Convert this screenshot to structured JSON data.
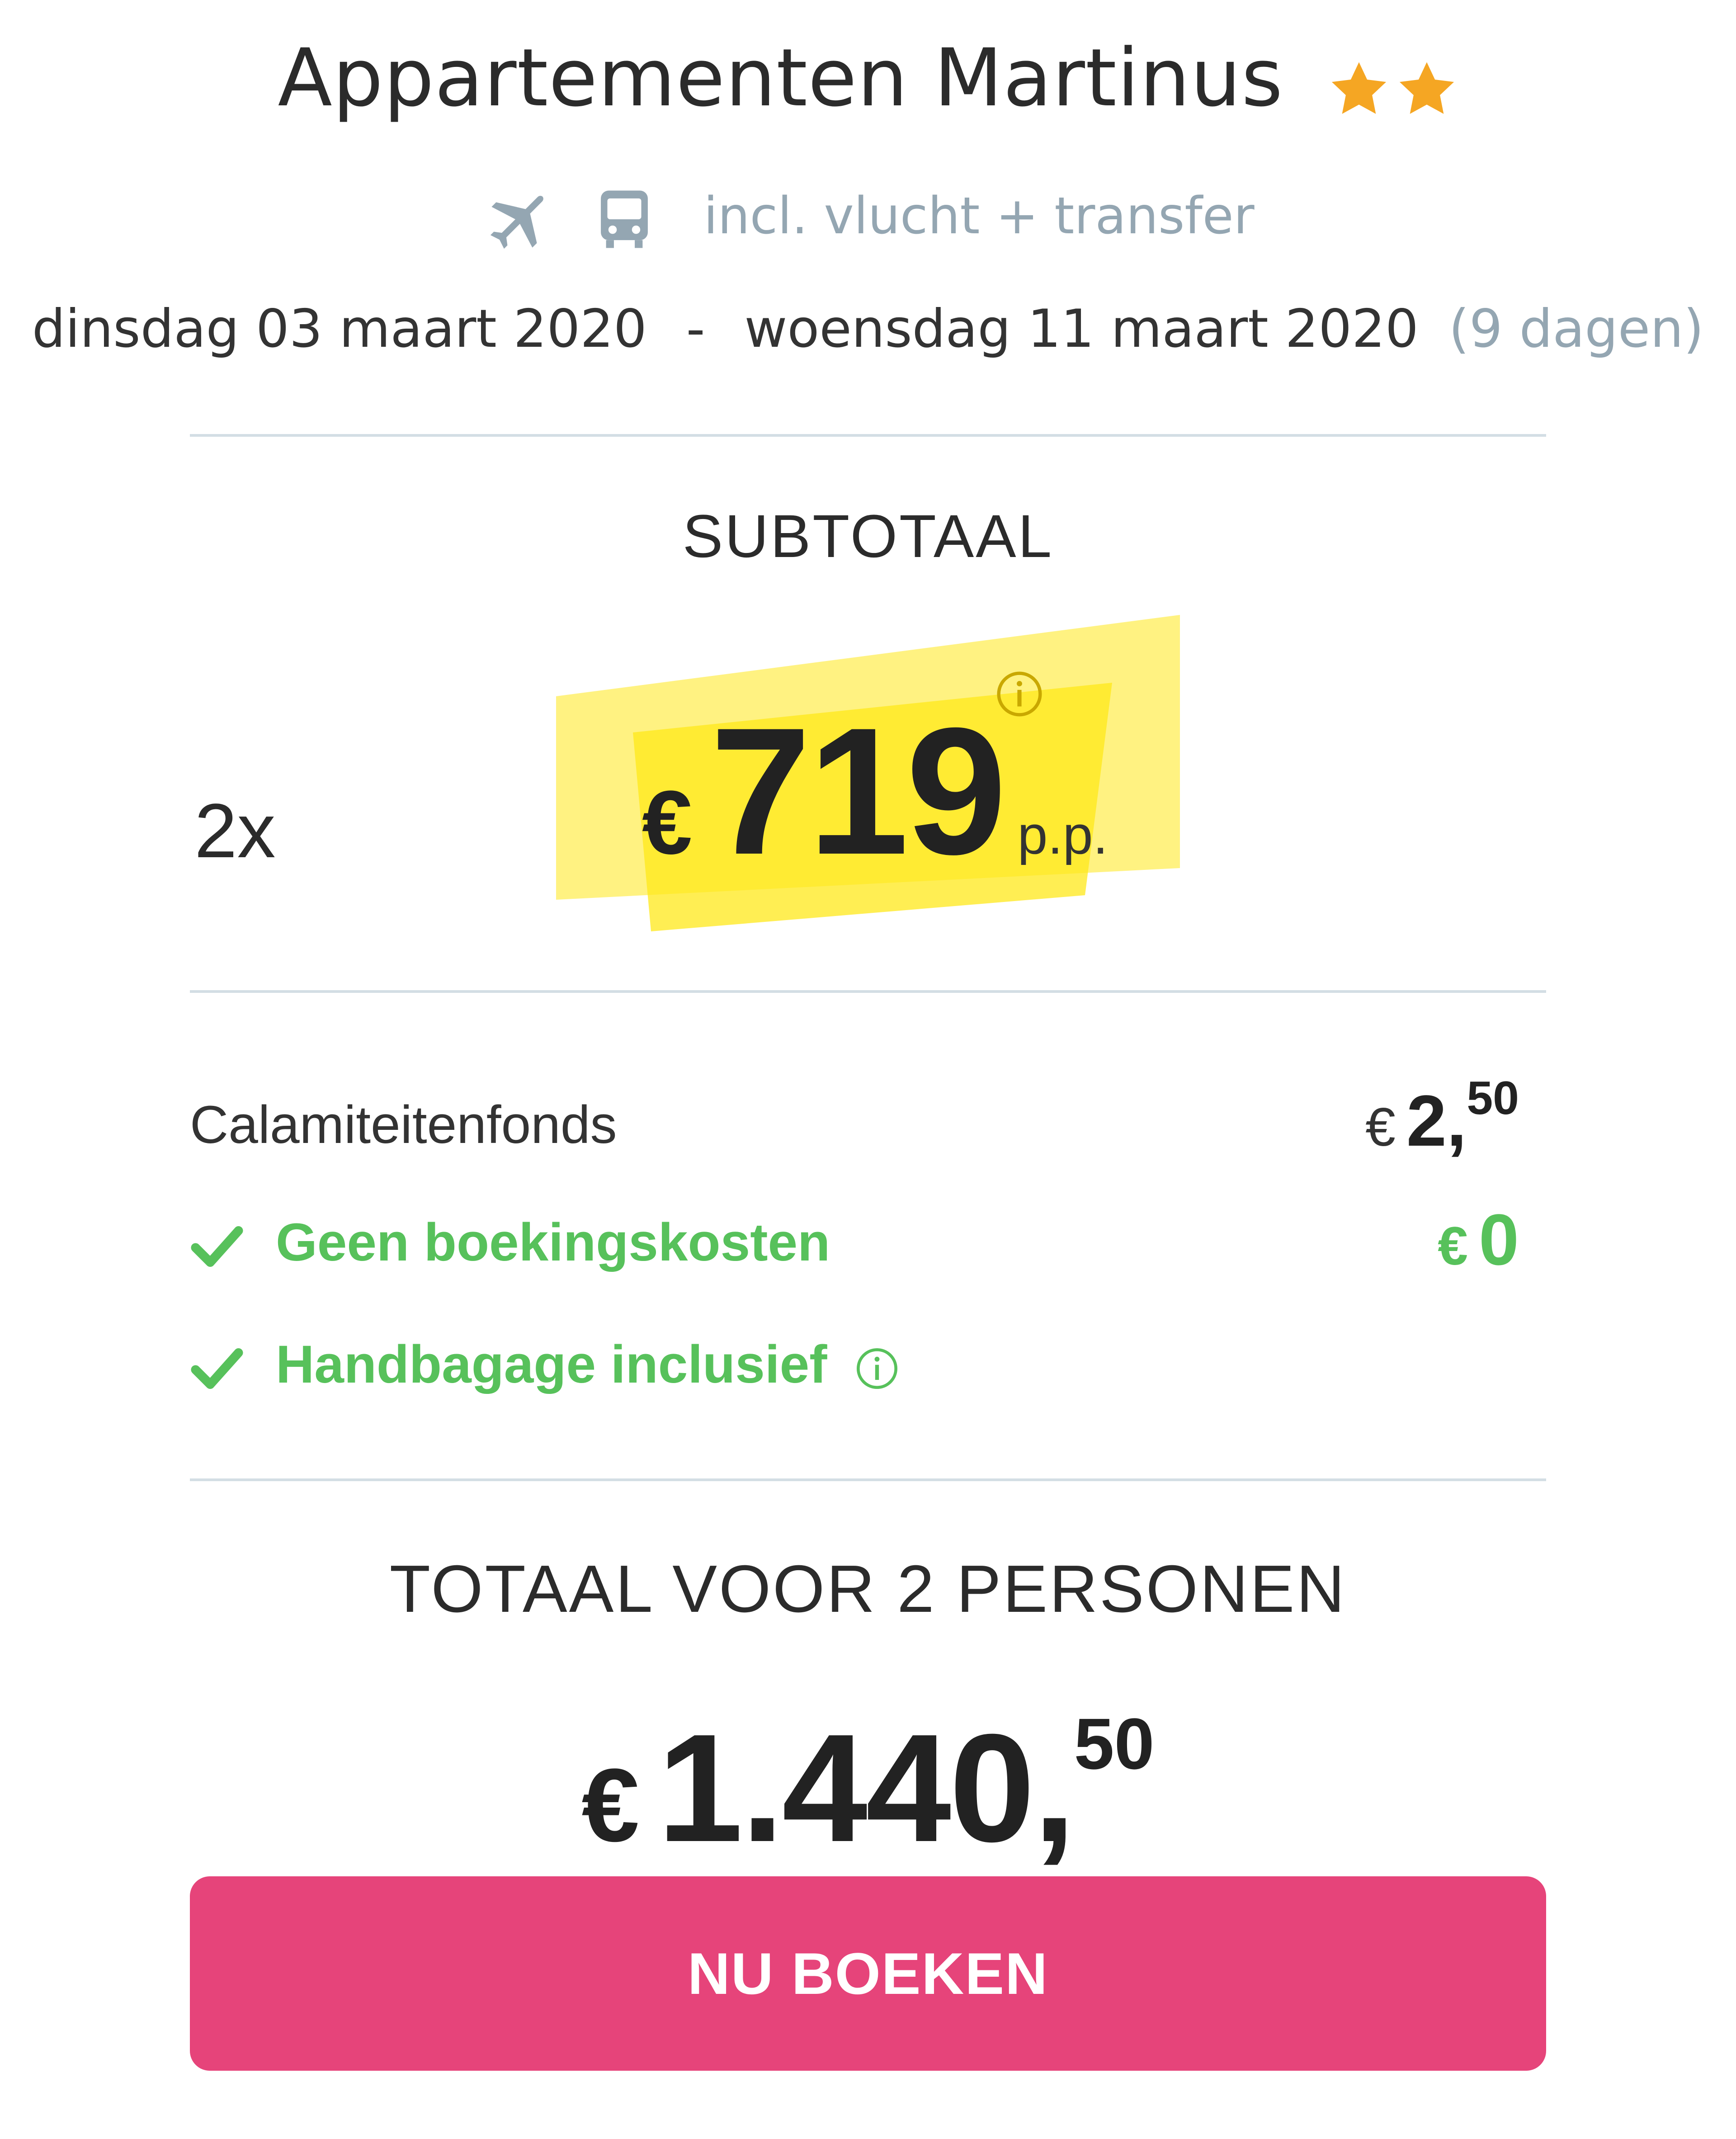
{
  "header": {
    "title": "Appartementen Martinus",
    "stars": 2,
    "travel_info": "incl. vlucht + transfer",
    "date_start": "dinsdag 03 maart 2020",
    "date_separator": "-",
    "date_end": "woensdag 11 maart 2020",
    "duration": "(9 dagen)"
  },
  "subtotal": {
    "label": "SUBTOTAAL",
    "quantity": "2x",
    "currency": "€",
    "price": "719",
    "per_person": "p.p."
  },
  "costs": [
    {
      "label": "Calamiteitenfonds",
      "currency": "€",
      "amount_int": "2,",
      "amount_sup": "50"
    },
    {
      "label": "Geen boekingskosten",
      "currency": "€",
      "amount_int": "0",
      "amount_sup": ""
    },
    {
      "label": "Handbagage inclusief"
    }
  ],
  "total": {
    "label": "TOTAAL VOOR 2 PERSONEN",
    "currency": "€",
    "amount_int": "1.440,",
    "amount_sup": "50"
  },
  "cta": {
    "label": "NU BOEKEN"
  },
  "colors": {
    "accent_pink": "#e6447a",
    "highlight_yellow": "#ffe81a",
    "success_green": "#57c15b",
    "star_orange": "#f5a623",
    "muted_blue_gray": "#94a6b2"
  },
  "icons": [
    "star-icon",
    "plane-icon",
    "bus-icon",
    "info-icon",
    "check-icon"
  ]
}
